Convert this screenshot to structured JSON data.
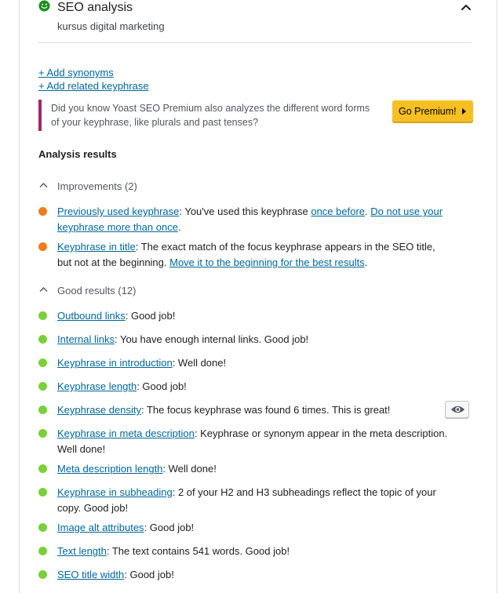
{
  "header": {
    "title": "SEO analysis",
    "keyphrase": "kursus digital marketing",
    "smiley_icon": "smiley-icon",
    "collapse_icon": "chevron-up-icon"
  },
  "links": {
    "add_synonyms": "+ Add synonyms",
    "add_related": "+ Add related keyphrase"
  },
  "premium": {
    "text": "Did you know Yoast SEO Premium also analyzes the different word forms of your keyphrase, like plurals and past tenses?",
    "button": "Go Premium!",
    "accent": "#a4286a",
    "button_color": "#f6c022"
  },
  "analysis": {
    "title": "Analysis results",
    "improvements_label": "Improvements (2)",
    "good_label": "Good results (12)",
    "improvement_color": "#ee7c1b",
    "good_color": "#7ad03a",
    "improvements": [
      {
        "link": "Previously used keyphrase",
        "text": ": You've used this keyphrase ",
        "link2": "once before",
        "text2": ". ",
        "link3": "Do not use your keyphrase more than once",
        "text3": "."
      },
      {
        "link": "Keyphrase in title",
        "text": ": The exact match of the focus keyphrase appears in the SEO title, but not at the beginning. ",
        "link2": "Move it to the beginning for the best results",
        "text2": "."
      }
    ],
    "good": [
      {
        "link": "Outbound links",
        "text": ": Good job!"
      },
      {
        "link": "Internal links",
        "text": ": You have enough internal links. Good job!"
      },
      {
        "link": "Keyphrase in introduction",
        "text": ": Well done!"
      },
      {
        "link": "Keyphrase length",
        "text": ": Good job!"
      },
      {
        "link": "Keyphrase density",
        "text": ": The focus keyphrase was found 6 times. This is great!"
      },
      {
        "link": "Keyphrase in meta description",
        "text": ": Keyphrase or synonym appear in the meta description. Well done!"
      },
      {
        "link": "Meta description length",
        "text": ": Well done!"
      },
      {
        "link": "Keyphrase in subheading",
        "text": ": 2 of your H2 and H3 subheadings reflect the topic of your copy. Good job!"
      },
      {
        "link": "Image alt attributes",
        "text": ": Good job!"
      },
      {
        "link": "Text length",
        "text": ": The text contains 541 words. Good job!"
      },
      {
        "link": "SEO title width",
        "text": ": Good job!"
      }
    ]
  },
  "eye_icon": "eye-icon"
}
